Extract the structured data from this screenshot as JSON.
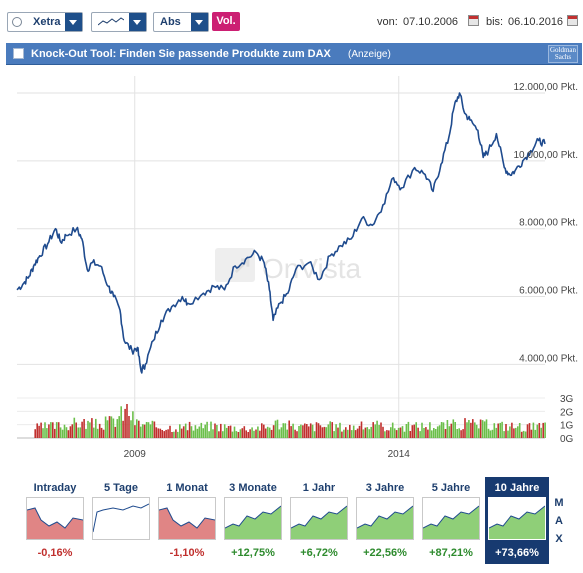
{
  "toolbar": {
    "exchange": "Xetra",
    "scale": "Abs",
    "volume_button": "Vol.",
    "from_label": "von:",
    "from_date": "07.10.2006",
    "to_label": "bis:",
    "to_date": "06.10.2016"
  },
  "banner": {
    "title": "Knock-Out Tool: Finden Sie passende Produkte zum DAX",
    "ad_label": "(Anzeige)",
    "logo_line1": "Goldman",
    "logo_line2": "Sachs"
  },
  "watermark": "OnVista",
  "chart_data": {
    "type": "line",
    "series": [
      {
        "x": [
          2006.77,
          2006.9,
          2007.0,
          2007.1,
          2007.2,
          2007.35,
          2007.5,
          2007.6,
          2007.7,
          2007.9,
          2008.0,
          2008.1,
          2008.2,
          2008.35,
          2008.5,
          2008.6,
          2008.72,
          2008.8,
          2008.95,
          2009.05,
          2009.12,
          2009.2,
          2009.35,
          2009.5,
          2009.7,
          2009.9,
          2010.0,
          2010.3,
          2010.5,
          2010.7,
          2010.9,
          2011.1,
          2011.3,
          2011.45,
          2011.55,
          2011.62,
          2011.75,
          2011.9,
          2012.05,
          2012.3,
          2012.5,
          2012.7,
          2012.9,
          2013.1,
          2013.3,
          2013.5,
          2013.7,
          2013.9,
          2014.05,
          2014.3,
          2014.5,
          2014.65,
          2014.8,
          2014.95,
          2015.05,
          2015.15,
          2015.25,
          2015.35,
          2015.5,
          2015.6,
          2015.7,
          2015.85,
          2016.0,
          2016.1,
          2016.2,
          2016.35,
          2016.5,
          2016.65,
          2016.77
        ],
        "y": [
          6200,
          6400,
          6600,
          6950,
          7200,
          7550,
          8000,
          7600,
          7800,
          8000,
          7700,
          6800,
          7000,
          6900,
          6300,
          6000,
          5600,
          4700,
          4400,
          4500,
          3800,
          4000,
          4700,
          5300,
          5700,
          6000,
          5800,
          6100,
          6300,
          6200,
          6900,
          7100,
          7300,
          7000,
          6200,
          5300,
          5800,
          6100,
          6800,
          7000,
          6500,
          7200,
          7500,
          7700,
          8300,
          8100,
          8700,
          9500,
          9200,
          9800,
          9600,
          9100,
          9900,
          10700,
          11600,
          12000,
          11400,
          11200,
          10900,
          10100,
          10300,
          10800,
          9800,
          9600,
          9700,
          10000,
          10300,
          10600,
          10500
        ]
      }
    ],
    "volume": {
      "x": [
        2007.0,
        2007.5,
        2007.8,
        2008.0,
        2008.3,
        2008.6,
        2008.85,
        2009.0,
        2009.3,
        2009.6,
        2010.0,
        2010.5,
        2011.0,
        2011.5,
        2011.7,
        2012.0,
        2012.5,
        2013.0,
        2013.5,
        2014.0,
        2014.5,
        2015.0,
        2015.2,
        2015.6,
        2016.0,
        2016.5
      ],
      "y": [
        0.9,
        1.1,
        1.3,
        1.4,
        1.2,
        1.6,
        2.6,
        1.4,
        1.1,
        1.0,
        1.0,
        1.1,
        0.9,
        1.0,
        1.4,
        1.0,
        1.1,
        1.0,
        1.1,
        1.0,
        1.1,
        1.2,
        1.3,
        1.2,
        1.1,
        1.0
      ]
    },
    "xticks": [
      {
        "value": 2009,
        "label": "2009"
      },
      {
        "value": 2014,
        "label": "2014"
      }
    ],
    "yticks": [
      {
        "value": 12000,
        "label": "12.000,00 Pkt."
      },
      {
        "value": 10000,
        "label": "10.000,00 Pkt."
      },
      {
        "value": 8000,
        "label": "8.000,00 Pkt."
      },
      {
        "value": 6000,
        "label": "6.000,00 Pkt."
      },
      {
        "value": 4000,
        "label": "4.000,00 Pkt."
      }
    ],
    "volume_ticks": [
      {
        "value": 3,
        "label": "3G"
      },
      {
        "value": 2,
        "label": "2G"
      },
      {
        "value": 1,
        "label": "1G"
      },
      {
        "value": 0,
        "label": "0G"
      }
    ],
    "xlim": [
      2006.77,
      2016.77
    ],
    "ylim": [
      3600,
      12500
    ],
    "volume_ylim": [
      0,
      3
    ],
    "grid": true,
    "colors": {
      "line": "#1f4b8e",
      "volume_up": "#6bbf4a",
      "volume_down": "#c0302e"
    }
  },
  "periods": [
    {
      "label": "Intraday",
      "change": "-0,16%",
      "trend": "down",
      "active": false
    },
    {
      "label": "5 Tage",
      "change": "",
      "trend": "flat",
      "active": false
    },
    {
      "label": "1 Monat",
      "change": "-1,10%",
      "trend": "down",
      "active": false
    },
    {
      "label": "3 Monate",
      "change": "+12,75%",
      "trend": "up",
      "active": false
    },
    {
      "label": "1 Jahr",
      "change": "+6,72%",
      "trend": "up",
      "active": false
    },
    {
      "label": "3 Jahre",
      "change": "+22,56%",
      "trend": "up",
      "active": false
    },
    {
      "label": "5 Jahre",
      "change": "+87,21%",
      "trend": "up",
      "active": false
    },
    {
      "label": "10 Jahre",
      "change": "+73,66%",
      "trend": "up",
      "active": true
    }
  ],
  "max_label": [
    "M",
    "A",
    "X"
  ]
}
